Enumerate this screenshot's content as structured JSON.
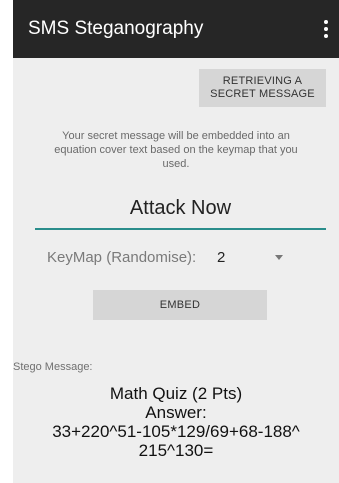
{
  "appbar": {
    "title": "SMS Steganography",
    "overflow_icon": "more-vert-icon"
  },
  "retrieve_button": {
    "line1": "RETRIEVING A",
    "line2": "SECRET MESSAGE"
  },
  "info_text": {
    "line1": "Your secret message will be embedded into an",
    "line2": "equation cover text based on the keymap that you",
    "line3": "used."
  },
  "message_input": {
    "value": "Attack Now"
  },
  "keymap": {
    "label": "KeyMap (Randomise):",
    "selected": "2",
    "dropdown_icon": "dropdown-arrow-icon"
  },
  "embed_button": {
    "label": "EMBED"
  },
  "stego": {
    "label": "Stego Message:",
    "line1": "Math Quiz (2 Pts)",
    "line2": "Answer:",
    "line3": "33+220^51-105*129/69+68-188^",
    "line4": "215^130="
  },
  "colors": {
    "appbar_bg": "#262626",
    "accent": "#2a8d8b",
    "screen_bg": "#eeeeee",
    "button_bg": "#d6d6d6"
  }
}
